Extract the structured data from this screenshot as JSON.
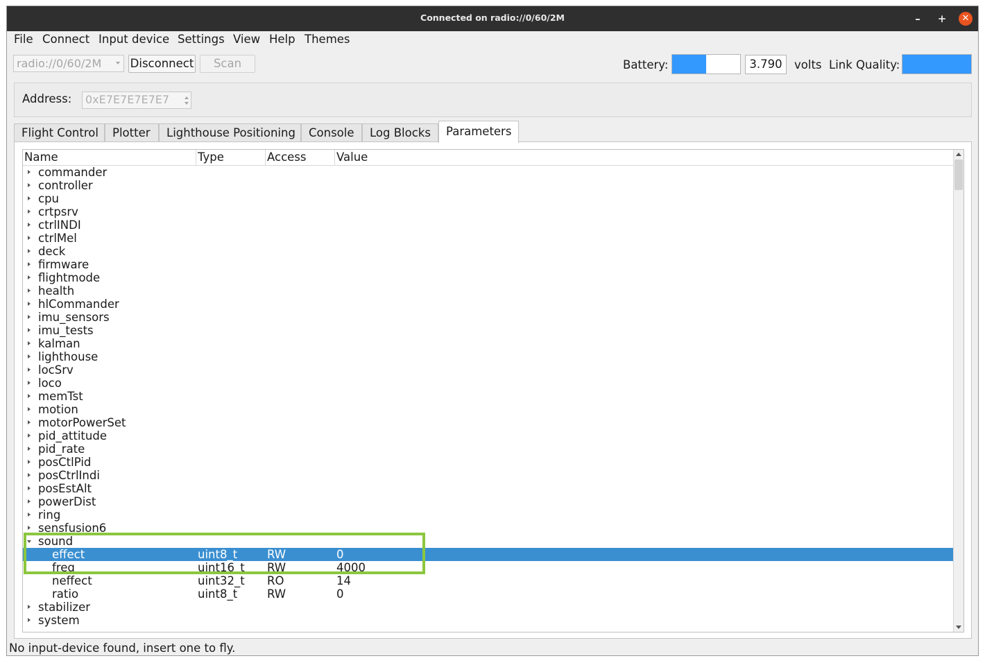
{
  "window": {
    "title": "Connected on radio://0/60/2M"
  },
  "menu": [
    "File",
    "Connect",
    "Input device",
    "Settings",
    "View",
    "Help",
    "Themes"
  ],
  "toolbar": {
    "radio_uri": "radio://0/60/2M",
    "disconnect_label": "Disconnect",
    "scan_label": "Scan",
    "battery_label": "Battery:",
    "battery_level_fraction": 0.5,
    "voltage": "3.790",
    "volts_label": "volts",
    "link_quality_label": "Link Quality:",
    "link_quality_fraction": 1.0
  },
  "address": {
    "label": "Address:",
    "value": "0xE7E7E7E7E7"
  },
  "tabs": [
    "Flight Control",
    "Plotter",
    "Lighthouse Positioning",
    "Console",
    "Log Blocks",
    "Parameters"
  ],
  "active_tab": "Parameters",
  "param_table": {
    "headers": [
      "Name",
      "Type",
      "Access",
      "Value"
    ],
    "rows": [
      {
        "name": "commander",
        "expander": "collapsed"
      },
      {
        "name": "controller",
        "expander": "collapsed"
      },
      {
        "name": "cpu",
        "expander": "collapsed"
      },
      {
        "name": "crtpsrv",
        "expander": "collapsed"
      },
      {
        "name": "ctrlINDI",
        "expander": "collapsed"
      },
      {
        "name": "ctrlMel",
        "expander": "collapsed"
      },
      {
        "name": "deck",
        "expander": "collapsed"
      },
      {
        "name": "firmware",
        "expander": "collapsed"
      },
      {
        "name": "flightmode",
        "expander": "collapsed"
      },
      {
        "name": "health",
        "expander": "collapsed"
      },
      {
        "name": "hlCommander",
        "expander": "collapsed"
      },
      {
        "name": "imu_sensors",
        "expander": "collapsed"
      },
      {
        "name": "imu_tests",
        "expander": "collapsed"
      },
      {
        "name": "kalman",
        "expander": "collapsed"
      },
      {
        "name": "lighthouse",
        "expander": "collapsed"
      },
      {
        "name": "locSrv",
        "expander": "collapsed"
      },
      {
        "name": "loco",
        "expander": "collapsed"
      },
      {
        "name": "memTst",
        "expander": "collapsed"
      },
      {
        "name": "motion",
        "expander": "collapsed"
      },
      {
        "name": "motorPowerSet",
        "expander": "collapsed"
      },
      {
        "name": "pid_attitude",
        "expander": "collapsed"
      },
      {
        "name": "pid_rate",
        "expander": "collapsed"
      },
      {
        "name": "posCtlPid",
        "expander": "collapsed"
      },
      {
        "name": "posCtrlIndi",
        "expander": "collapsed"
      },
      {
        "name": "posEstAlt",
        "expander": "collapsed"
      },
      {
        "name": "powerDist",
        "expander": "collapsed"
      },
      {
        "name": "ring",
        "expander": "collapsed"
      },
      {
        "name": "sensfusion6",
        "expander": "collapsed"
      },
      {
        "name": "sound",
        "expander": "expanded"
      },
      {
        "name": "effect",
        "type": "uint8_t",
        "access": "RW",
        "value": "0",
        "child": true,
        "selected": true
      },
      {
        "name": "freq",
        "type": "uint16_t",
        "access": "RW",
        "value": "4000",
        "child": true
      },
      {
        "name": "neffect",
        "type": "uint32_t",
        "access": "RO",
        "value": "14",
        "child": true
      },
      {
        "name": "ratio",
        "type": "uint8_t",
        "access": "RW",
        "value": "0",
        "child": true
      },
      {
        "name": "stabilizer",
        "expander": "collapsed"
      },
      {
        "name": "system",
        "expander": "collapsed"
      }
    ]
  },
  "status": "No input-device found, insert one to fly.",
  "colors": {
    "selection": "#3a8fd1",
    "highlight_box": "#8cc63f",
    "level_fill": "#3399ff",
    "titlebar": "#2f2f2f",
    "close_button": "#e95420"
  }
}
